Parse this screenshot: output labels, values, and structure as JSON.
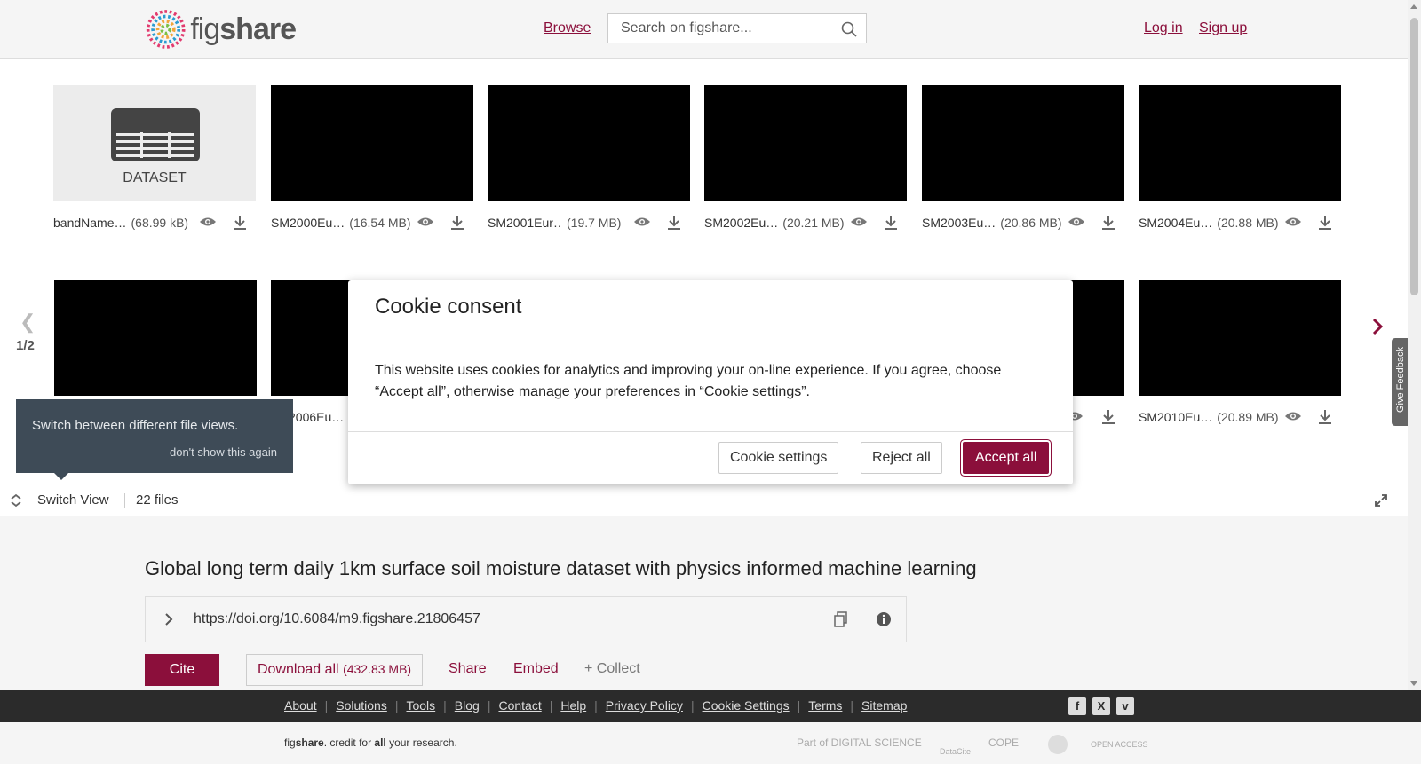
{
  "header": {
    "logo_text_light": "fig",
    "logo_text_bold": "share",
    "browse": "Browse",
    "search_placeholder": "Search on figshare...",
    "login": "Log in",
    "signup": "Sign up"
  },
  "files_row1": [
    {
      "name": "bandName…",
      "size": "(68.99 kB)",
      "type_label": "DATASET"
    },
    {
      "name": "SM2000Eu…",
      "size": "(16.54 MB)"
    },
    {
      "name": "SM2001Eur…",
      "size": "(19.7 MB)"
    },
    {
      "name": "SM2002Eu…",
      "size": "(20.21 MB)"
    },
    {
      "name": "SM2003Eu…",
      "size": "(20.86 MB)"
    },
    {
      "name": "SM2004Eu…",
      "size": "(20.88 MB)"
    }
  ],
  "files_row2": [
    {
      "name": "",
      "size": ""
    },
    {
      "name": "2006Eu…",
      "size": ""
    },
    {
      "name": "",
      "size": ""
    },
    {
      "name": "",
      "size": ""
    },
    {
      "name": "",
      "size": ""
    },
    {
      "name": "SM2010Eu…",
      "size": "(20.89 MB)"
    }
  ],
  "pager": "1/2",
  "tooltip": {
    "text": "Switch between different file views.",
    "dismiss": "don't show this again"
  },
  "switchbar": {
    "label": "Switch View",
    "files": "22 files"
  },
  "article": {
    "title": "Global long term daily 1km surface soil moisture dataset with physics informed machine learning",
    "doi": "https://doi.org/10.6084/m9.figshare.21806457",
    "cite": "Cite",
    "download_all": "Download all",
    "download_size": "(432.83 MB)",
    "share": "Share",
    "embed": "Embed",
    "collect": "+ Collect"
  },
  "modal": {
    "title": "Cookie consent",
    "body": "This website uses cookies for analytics and improving your on-line experience. If you agree, choose “Accept all”, otherwise manage your preferences in “Cookie settings”.",
    "settings": "Cookie settings",
    "reject": "Reject all",
    "accept": "Accept all"
  },
  "footer": {
    "links": [
      "About",
      "Solutions",
      "Tools",
      "Blog",
      "Contact",
      "Help",
      "Privacy Policy",
      "Cookie Settings",
      "Terms",
      "Sitemap"
    ],
    "social": [
      "facebook-icon",
      "x-icon",
      "vimeo-icon"
    ],
    "tagline_fig": "fig",
    "tagline_share": "share",
    "tagline_mid": ". credit for ",
    "tagline_all": "all",
    "tagline_end": " your research.",
    "partner_digital": "Part of DIGITAL SCIENCE",
    "partner_datacite": "DataCite",
    "partner_cope": "COPE",
    "partner_openaccess": "OPEN ACCESS"
  },
  "feedback": "Give Feedback",
  "colors": {
    "brand": "#8b0f3b",
    "footer_dark": "#2b2b2b",
    "tooltip": "#3e4b57"
  }
}
